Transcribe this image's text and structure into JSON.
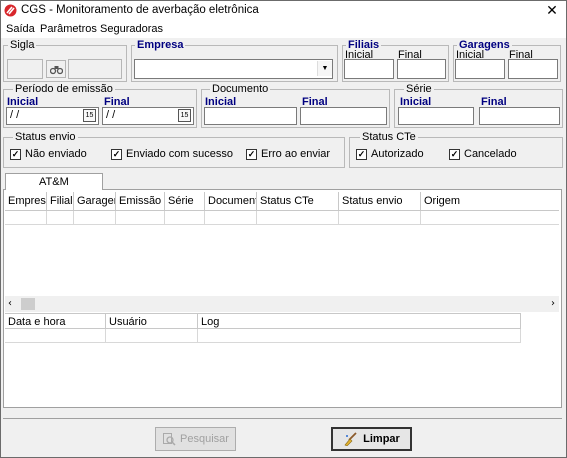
{
  "window": {
    "title": "CGS - Monitoramento de averbação eletrônica",
    "close_glyph": "✕",
    "icon": "app-logo-icon"
  },
  "menu": [
    {
      "label": "Saída"
    },
    {
      "label": "Parâmetros"
    },
    {
      "label": "Seguradoras"
    }
  ],
  "filters": {
    "sigla": {
      "label": "Sigla",
      "search_icon": "binoculars-icon"
    },
    "empresa": {
      "label": "Empresa",
      "value": ""
    },
    "filiais": {
      "label": "Filiais",
      "inicial": "Inicial",
      "final": "Final"
    },
    "garagens": {
      "label": "Garagens",
      "inicial": "Inicial",
      "final": "Final"
    },
    "periodo": {
      "label": "Período de emissão",
      "inicial": "Inicial",
      "final": "Final",
      "inicial_value": " / /",
      "final_value": " / /",
      "calendar_text": "15"
    },
    "documento": {
      "label": "Documento",
      "inicial": "Inicial",
      "final": "Final"
    },
    "serie": {
      "label": "Série",
      "inicial": "Inicial",
      "final": "Final"
    },
    "status_envio": {
      "label": "Status envio",
      "options": [
        {
          "label": "Não enviado",
          "checked": true
        },
        {
          "label": "Enviado com sucesso",
          "checked": true
        },
        {
          "label": "Erro ao enviar",
          "checked": true
        }
      ]
    },
    "status_cte": {
      "label": "Status CTe",
      "options": [
        {
          "label": "Autorizado",
          "checked": true
        },
        {
          "label": "Cancelado",
          "checked": true
        }
      ]
    }
  },
  "tabs": [
    {
      "label": "AT&M"
    }
  ],
  "main_grid": {
    "columns": [
      "Empresa",
      "Filial",
      "Garagem",
      "Emissão",
      "Série",
      "Documento",
      "Status CTe",
      "Status envio",
      "Origem"
    ]
  },
  "log_grid": {
    "columns": [
      "Data e hora",
      "Usuário",
      "Log"
    ]
  },
  "buttons": {
    "pesquisar": {
      "label": "Pesquisar",
      "enabled": false
    },
    "limpar": {
      "label": "Limpar",
      "enabled": true
    }
  }
}
